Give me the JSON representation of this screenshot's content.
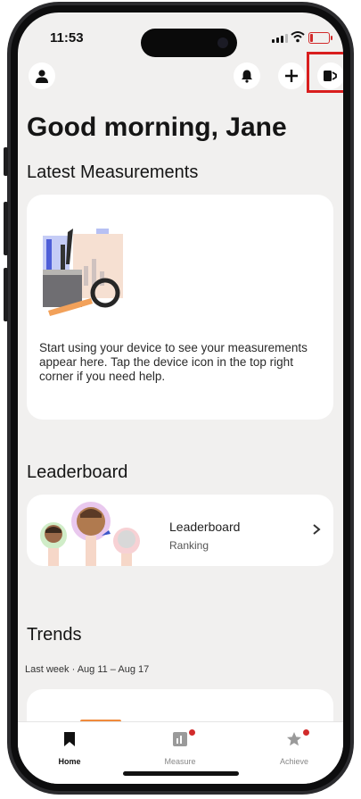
{
  "status_bar": {
    "time": "11:53"
  },
  "header": {
    "profile_icon": "person-icon",
    "notifications_icon": "bell-icon",
    "add_icon": "plus-icon",
    "device_icon": "device-icon",
    "highlight_color": "#d91e1e"
  },
  "greeting": "Good morning, Jane",
  "latest": {
    "title": "Latest Measurements",
    "empty_text": "Start using your device to see your measurements appear here. Tap the device icon in the top right corner if you need help."
  },
  "leaderboard": {
    "title": "Leaderboard",
    "card_title": "Leaderboard",
    "card_subtitle": "Ranking"
  },
  "trends": {
    "title": "Trends",
    "subtitle": "Last week · Aug 11 – Aug 17"
  },
  "tabbar": {
    "tabs": [
      {
        "label": "Home",
        "icon": "bookmark-icon",
        "active": true
      },
      {
        "label": "Measure",
        "icon": "chart-icon",
        "badge": true
      },
      {
        "label": "Achieve",
        "icon": "star-icon",
        "badge": true
      }
    ]
  },
  "colors": {
    "accent_orange": "#f08a3c",
    "badge_red": "#d22b2b",
    "screen_bg": "#f1f0ef"
  }
}
